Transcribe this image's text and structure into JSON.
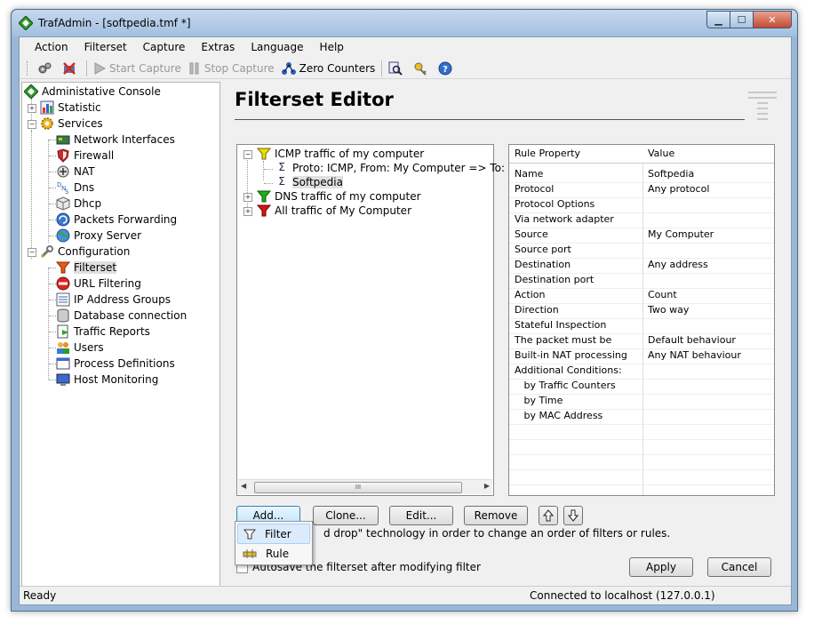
{
  "window": {
    "title": "TrafAdmin - [softpedia.tmf *]"
  },
  "menu": [
    "Action",
    "Filterset",
    "Capture",
    "Extras",
    "Language",
    "Help"
  ],
  "toolbar": {
    "start_capture": "Start Capture",
    "stop_capture": "Stop Capture",
    "zero_counters": "Zero Counters"
  },
  "nav": {
    "root": "Administative Console",
    "statistic": "Statistic",
    "services": "Services",
    "services_items": [
      "Network Interfaces",
      "Firewall",
      "NAT",
      "Dns",
      "Dhcp",
      "Packets Forwarding",
      "Proxy Server"
    ],
    "configuration": "Configuration",
    "configuration_items": [
      "Filterset",
      "URL Filtering",
      "IP Address Groups",
      "Database connection",
      "Traffic Reports",
      "Users",
      "Process Definitions",
      "Host Monitoring"
    ]
  },
  "editor": {
    "title": "Filterset Editor",
    "filters": [
      {
        "label": "ICMP traffic of my computer",
        "color": "#e8e000"
      },
      {
        "label": "Proto: ICMP, From: My Computer  => To: Any"
      },
      {
        "label": "Softpedia"
      },
      {
        "label": "DNS traffic of my computer",
        "color": "#19b219"
      },
      {
        "label": "All traffic of My Computer",
        "color": "#d81414"
      }
    ],
    "scroll_grip": "III",
    "properties_header": {
      "property": "Rule Property",
      "value": "Value"
    },
    "properties": [
      {
        "name": "Name",
        "value": "Softpedia"
      },
      {
        "name": "Protocol",
        "value": "Any protocol"
      },
      {
        "name": "Protocol Options",
        "value": ""
      },
      {
        "name": "Via network adapter",
        "value": ""
      },
      {
        "name": "Source",
        "value": "My Computer"
      },
      {
        "name": "Source port",
        "value": ""
      },
      {
        "name": "Destination",
        "value": "Any address"
      },
      {
        "name": "Destination port",
        "value": ""
      },
      {
        "name": "Action",
        "value": "Count"
      },
      {
        "name": "Direction",
        "value": "Two way"
      },
      {
        "name": "Stateful Inspection",
        "value": ""
      },
      {
        "name": "The packet must be",
        "value": "Default behaviour"
      },
      {
        "name": "Built-in NAT processing",
        "value": "Any NAT behaviour"
      },
      {
        "name": "Additional Conditions:",
        "value": ""
      },
      {
        "name": "   by Traffic Counters",
        "value": ""
      },
      {
        "name": "   by Time",
        "value": ""
      },
      {
        "name": "   by MAC Address",
        "value": ""
      }
    ],
    "buttons": {
      "add": "Add...",
      "clone": "Clone...",
      "edit": "Edit...",
      "remove": "Remove",
      "apply": "Apply",
      "cancel": "Cancel"
    },
    "hint": "d drop\" technology in order to change an order of filters or rules.",
    "autosave": "Autosave the filterset after modifying filter"
  },
  "add_menu": [
    "Filter",
    "Rule"
  ],
  "status": {
    "left": "Ready",
    "right": "Connected to localhost (127.0.0.1)"
  }
}
